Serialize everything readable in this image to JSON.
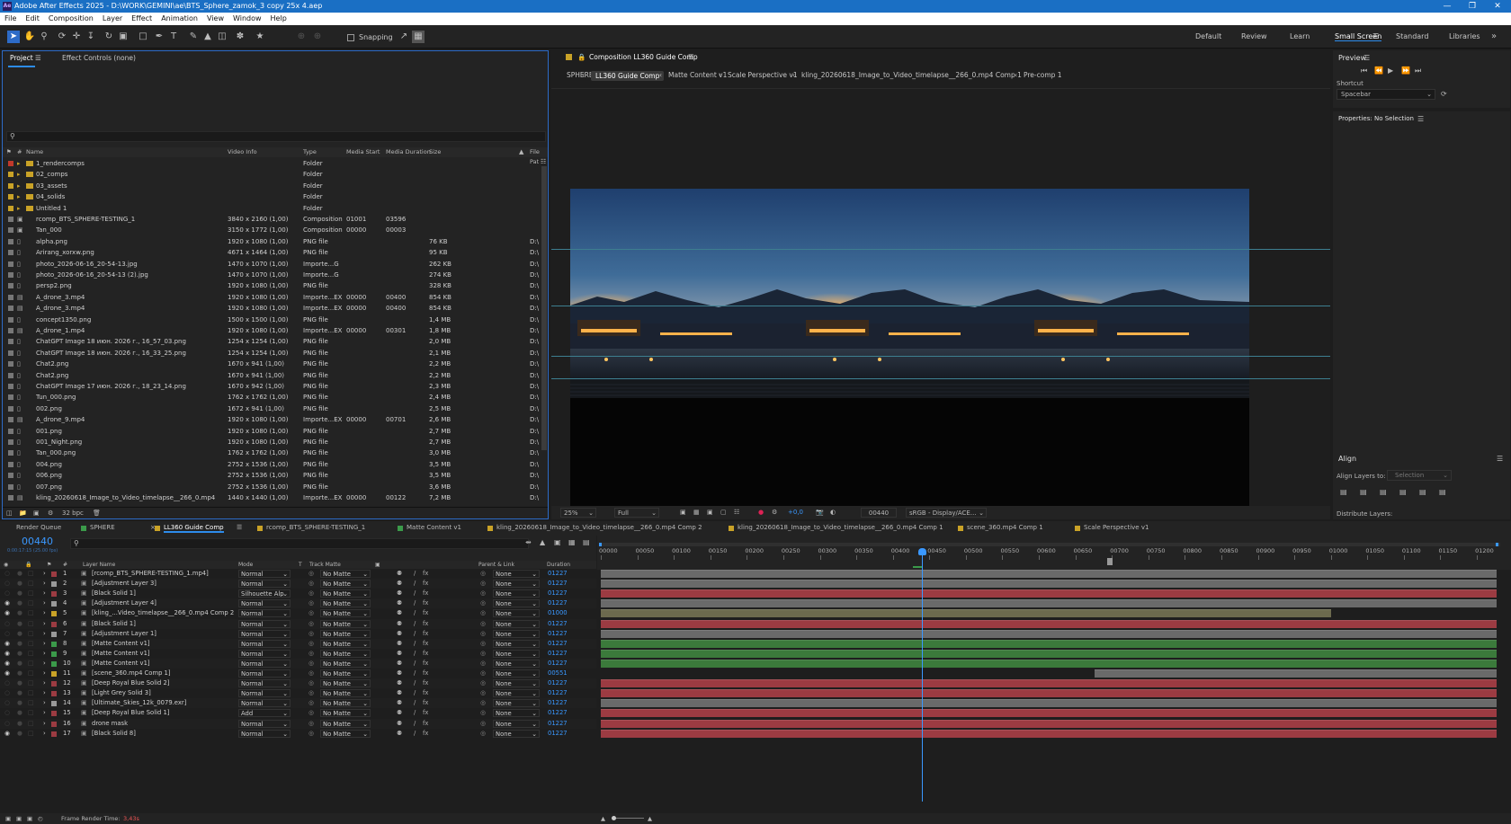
{
  "title": "Adobe After Effects 2025 - D:\\WORK\\GEMINI\\ae\\BTS_Sphere_zamok_3 copy 25x 4.aep",
  "menu": [
    "File",
    "Edit",
    "Composition",
    "Layer",
    "Effect",
    "Animation",
    "View",
    "Window",
    "Help"
  ],
  "toolbar": {
    "snapping": "Snapping"
  },
  "workspaces": [
    "Default",
    "Review",
    "Learn",
    "Small Screen",
    "Standard",
    "Libraries"
  ],
  "colors": {
    "accent": "#2d8ceb",
    "folder": "#c9a227",
    "timecode": "#3a98ff",
    "green": "#3b7a3b",
    "red": "#9c3b42",
    "gray": "#6a6a6a",
    "olive": "#6c6a4e"
  },
  "project": {
    "tab": "Project",
    "tab2": "Effect Controls (none)",
    "search_placeholder": "",
    "cols": [
      "Name",
      "Video Info",
      "Type",
      "Media Start",
      "Media Duration",
      "Size",
      "File Pat"
    ],
    "items": [
      {
        "name": "1_rendercomps",
        "info": "",
        "type": "Folder",
        "start": "",
        "dur": "",
        "size": "",
        "fp": "",
        "c": "#c0392b",
        "k": "folder"
      },
      {
        "name": "02_comps",
        "info": "",
        "type": "Folder",
        "start": "",
        "dur": "",
        "size": "",
        "fp": "",
        "c": "#c9a227",
        "k": "folder"
      },
      {
        "name": "03_assets",
        "info": "",
        "type": "Folder",
        "start": "",
        "dur": "",
        "size": "",
        "fp": "",
        "c": "#c9a227",
        "k": "folder"
      },
      {
        "name": "04_solids",
        "info": "",
        "type": "Folder",
        "start": "",
        "dur": "",
        "size": "",
        "fp": "",
        "c": "#c9a227",
        "k": "folder"
      },
      {
        "name": "Untitled 1",
        "info": "",
        "type": "Folder",
        "start": "",
        "dur": "",
        "size": "",
        "fp": "",
        "c": "#c9a227",
        "k": "folder"
      },
      {
        "name": "rcomp_BTS_SPHERE-TESTING_1",
        "info": "3840 x 2160 (1,00)",
        "type": "Composition",
        "start": "01001",
        "dur": "03596",
        "size": "",
        "fp": "",
        "c": "#777",
        "k": "comp"
      },
      {
        "name": "Tan_000",
        "info": "3150 x 1772 (1,00)",
        "type": "Composition",
        "start": "00000",
        "dur": "00003",
        "size": "",
        "fp": "",
        "c": "#777",
        "k": "comp"
      },
      {
        "name": "alpha.png",
        "info": "1920 x 1080 (1,00)",
        "type": "PNG file",
        "start": "",
        "dur": "",
        "size": "76 KB",
        "fp": "D:\\",
        "c": "#777",
        "k": "file"
      },
      {
        "name": "Arirang_xorxw.png",
        "info": "4671 x 1464 (1,00)",
        "type": "PNG file",
        "start": "",
        "dur": "",
        "size": "95 KB",
        "fp": "D:\\",
        "c": "#777",
        "k": "file"
      },
      {
        "name": "photo_2026-06-16_20-54-13.jpg",
        "info": "1470 x 1070 (1,00)",
        "type": "Importe...G",
        "start": "",
        "dur": "",
        "size": "262 KB",
        "fp": "D:\\",
        "c": "#777",
        "k": "file"
      },
      {
        "name": "photo_2026-06-16_20-54-13 (2).jpg",
        "info": "1470 x 1070 (1,00)",
        "type": "Importe...G",
        "start": "",
        "dur": "",
        "size": "274 KB",
        "fp": "D:\\",
        "c": "#777",
        "k": "file"
      },
      {
        "name": "persp2.png",
        "info": "1920 x 1080 (1,00)",
        "type": "PNG file",
        "start": "",
        "dur": "",
        "size": "328 KB",
        "fp": "D:\\",
        "c": "#777",
        "k": "file"
      },
      {
        "name": "A_drone_3.mp4",
        "info": "1920 x 1080 (1,00)",
        "type": "Importe...EX",
        "start": "00000",
        "dur": "00400",
        "size": "854 KB",
        "fp": "D:\\",
        "c": "#777",
        "k": "video"
      },
      {
        "name": "A_drone_3.mp4",
        "info": "1920 x 1080 (1,00)",
        "type": "Importe...EX",
        "start": "00000",
        "dur": "00400",
        "size": "854 KB",
        "fp": "D:\\",
        "c": "#777",
        "k": "video"
      },
      {
        "name": "concept1350.png",
        "info": "1500 x 1500 (1,00)",
        "type": "PNG file",
        "start": "",
        "dur": "",
        "size": "1,4 MB",
        "fp": "D:\\",
        "c": "#777",
        "k": "file"
      },
      {
        "name": "A_drone_1.mp4",
        "info": "1920 x 1080 (1,00)",
        "type": "Importe...EX",
        "start": "00000",
        "dur": "00301",
        "size": "1,8 MB",
        "fp": "D:\\",
        "c": "#777",
        "k": "video"
      },
      {
        "name": "ChatGPT Image 18 июн. 2026 г., 16_57_03.png",
        "info": "1254 x 1254 (1,00)",
        "type": "PNG file",
        "start": "",
        "dur": "",
        "size": "2,0 MB",
        "fp": "D:\\",
        "c": "#777",
        "k": "file"
      },
      {
        "name": "ChatGPT Image 18 июн. 2026 г., 16_33_25.png",
        "info": "1254 x 1254 (1,00)",
        "type": "PNG file",
        "start": "",
        "dur": "",
        "size": "2,1 MB",
        "fp": "D:\\",
        "c": "#777",
        "k": "file"
      },
      {
        "name": "Chat2.png",
        "info": "1670 x 941 (1,00)",
        "type": "PNG file",
        "start": "",
        "dur": "",
        "size": "2,2 MB",
        "fp": "D:\\",
        "c": "#777",
        "k": "file"
      },
      {
        "name": "Chat2.png",
        "info": "1670 x 941 (1,00)",
        "type": "PNG file",
        "start": "",
        "dur": "",
        "size": "2,2 MB",
        "fp": "D:\\",
        "c": "#777",
        "k": "file"
      },
      {
        "name": "ChatGPT Image 17 июн. 2026 г., 18_23_14.png",
        "info": "1670 x 942 (1,00)",
        "type": "PNG file",
        "start": "",
        "dur": "",
        "size": "2,3 MB",
        "fp": "D:\\",
        "c": "#777",
        "k": "file"
      },
      {
        "name": "Tun_000.png",
        "info": "1762 x 1762 (1,00)",
        "type": "PNG file",
        "start": "",
        "dur": "",
        "size": "2,4 MB",
        "fp": "D:\\",
        "c": "#777",
        "k": "file"
      },
      {
        "name": "002.png",
        "info": "1672 x 941 (1,00)",
        "type": "PNG file",
        "start": "",
        "dur": "",
        "size": "2,5 MB",
        "fp": "D:\\",
        "c": "#777",
        "k": "file"
      },
      {
        "name": "A_drone_9.mp4",
        "info": "1920 x 1080 (1,00)",
        "type": "Importe...EX",
        "start": "00000",
        "dur": "00701",
        "size": "2,6 MB",
        "fp": "D:\\",
        "c": "#777",
        "k": "video"
      },
      {
        "name": "001.png",
        "info": "1920 x 1080 (1,00)",
        "type": "PNG file",
        "start": "",
        "dur": "",
        "size": "2,7 MB",
        "fp": "D:\\",
        "c": "#777",
        "k": "file"
      },
      {
        "name": "001_Night.png",
        "info": "1920 x 1080 (1,00)",
        "type": "PNG file",
        "start": "",
        "dur": "",
        "size": "2,7 MB",
        "fp": "D:\\",
        "c": "#777",
        "k": "file"
      },
      {
        "name": "Tan_000.png",
        "info": "1762 x 1762 (1,00)",
        "type": "PNG file",
        "start": "",
        "dur": "",
        "size": "3,0 MB",
        "fp": "D:\\",
        "c": "#777",
        "k": "file"
      },
      {
        "name": "004.png",
        "info": "2752 x 1536 (1,00)",
        "type": "PNG file",
        "start": "",
        "dur": "",
        "size": "3,5 MB",
        "fp": "D:\\",
        "c": "#777",
        "k": "file"
      },
      {
        "name": "006.png",
        "info": "2752 x 1536 (1,00)",
        "type": "PNG file",
        "start": "",
        "dur": "",
        "size": "3,5 MB",
        "fp": "D:\\",
        "c": "#777",
        "k": "file"
      },
      {
        "name": "007.png",
        "info": "2752 x 1536 (1,00)",
        "type": "PNG file",
        "start": "",
        "dur": "",
        "size": "3,6 MB",
        "fp": "D:\\",
        "c": "#777",
        "k": "file"
      },
      {
        "name": "kling_20260618_Image_to_Video_timelapse__266_0.mp4",
        "info": "1440 x 1440 (1,00)",
        "type": "Importe...EX",
        "start": "00000",
        "dur": "00122",
        "size": "7,2 MB",
        "fp": "D:\\",
        "c": "#777",
        "k": "video"
      }
    ],
    "bpc": "32 bpc"
  },
  "comp": {
    "tab": "Composition LL360 Guide Comp",
    "crumbs": [
      "SPHERE",
      "LL360 Guide Comp",
      "Matte Content v1",
      "Scale Perspective v1",
      "kling_20260618_Image_to_Video_timelapse__266_0.mp4 Comp 1",
      "Pre-comp 1"
    ],
    "zoom": "25%",
    "res": "Full",
    "exposure": "+0,0",
    "frame": "00440",
    "colorspace": "sRGB - Display/ACE..."
  },
  "preview": {
    "title": "Preview",
    "shortcut_label": "Shortcut",
    "shortcut": "Spacebar",
    "properties": "Properties: No Selection",
    "align": "Align",
    "align_to_label": "Align Layers to:",
    "align_to": "Selection",
    "distribute": "Distribute Layers:"
  },
  "timeline": {
    "tabs": [
      {
        "label": "Render Queue",
        "c": ""
      },
      {
        "label": "SPHERE",
        "c": "#3b9a4a"
      },
      {
        "label": "LL360 Guide Comp",
        "c": "#c9a227"
      },
      {
        "label": "rcomp_BTS_SPHERE-TESTING_1",
        "c": "#c9a227"
      },
      {
        "label": "Matte Content v1",
        "c": "#3b9a4a"
      },
      {
        "label": "kling_20260618_Image_to_Video_timelapse__266_0.mp4 Comp 2",
        "c": "#c9a227"
      },
      {
        "label": "kling_20260618_Image_to_Video_timelapse__266_0.mp4 Comp 1",
        "c": "#c9a227"
      },
      {
        "label": "scene_360.mp4 Comp 1",
        "c": "#c9a227"
      },
      {
        "label": "Scale Perspective v1",
        "c": "#c9a227"
      }
    ],
    "timecode": "00440",
    "tc_sub": "0:00:17:15 (25.00 fps)",
    "search_placeholder": "",
    "cols": {
      "name": "Layer Name",
      "mode": "Mode",
      "t": "T",
      "matte": "Track Matte",
      "parent": "Parent & Link",
      "dur": "Duration"
    },
    "layers": [
      {
        "n": "1",
        "name": "[rcomp_BTS_SPHERE-TESTING_1.mp4]",
        "mode": "Normal",
        "matte": "No Matte",
        "parent": "None",
        "dur": "01227",
        "c": "#9c3b42",
        "eye": false,
        "bar": "gray",
        "b0": 0,
        "b1": 1
      },
      {
        "n": "2",
        "name": "[Adjustment Layer 3]",
        "mode": "Normal",
        "matte": "No Matte",
        "parent": "None",
        "dur": "01227",
        "c": "#999",
        "eye": false,
        "bar": "gray",
        "b0": 0,
        "b1": 1
      },
      {
        "n": "3",
        "name": "[Black Solid 1]",
        "mode": "Silhouette Alp",
        "matte": "No Matte",
        "parent": "None",
        "dur": "01227",
        "c": "#9c3b42",
        "eye": false,
        "bar": "red",
        "b0": 0,
        "b1": 1
      },
      {
        "n": "4",
        "name": "[Adjustment Layer 4]",
        "mode": "Normal",
        "matte": "No Matte",
        "parent": "None",
        "dur": "01227",
        "c": "#999",
        "eye": true,
        "bar": "gray",
        "b0": 0,
        "b1": 1
      },
      {
        "n": "5",
        "name": "[kling_...Video_timelapse__266_0.mp4 Comp 2]",
        "mode": "Normal",
        "matte": "No Matte",
        "parent": "None",
        "dur": "01000",
        "c": "#c9a227",
        "eye": true,
        "bar": "olive",
        "b0": 0,
        "b1": 0.8155
      },
      {
        "n": "6",
        "name": "[Black Solid 1]",
        "mode": "Normal",
        "matte": "No Matte",
        "parent": "None",
        "dur": "01227",
        "c": "#9c3b42",
        "eye": false,
        "bar": "red",
        "b0": 0,
        "b1": 1
      },
      {
        "n": "7",
        "name": "[Adjustment Layer 1]",
        "mode": "Normal",
        "matte": "No Matte",
        "parent": "None",
        "dur": "01227",
        "c": "#999",
        "eye": false,
        "bar": "gray",
        "b0": 0,
        "b1": 1
      },
      {
        "n": "8",
        "name": "[Matte Content v1]",
        "mode": "Normal",
        "matte": "No Matte",
        "parent": "None",
        "dur": "01227",
        "c": "#3b9a4a",
        "eye": true,
        "bar": "green",
        "b0": 0,
        "b1": 1
      },
      {
        "n": "9",
        "name": "[Matte Content v1]",
        "mode": "Normal",
        "matte": "No Matte",
        "parent": "None",
        "dur": "01227",
        "c": "#3b9a4a",
        "eye": true,
        "bar": "green",
        "b0": 0,
        "b1": 1
      },
      {
        "n": "10",
        "name": "[Matte Content v1]",
        "mode": "Normal",
        "matte": "No Matte",
        "parent": "None",
        "dur": "01227",
        "c": "#3b9a4a",
        "eye": true,
        "bar": "green",
        "b0": 0,
        "b1": 1
      },
      {
        "n": "11",
        "name": "[scene_360.mp4 Comp 1]",
        "mode": "Normal",
        "matte": "No Matte",
        "parent": "None",
        "dur": "00551",
        "c": "#c9a227",
        "eye": true,
        "bar": "gray",
        "b0": 0.551,
        "b1": 1
      },
      {
        "n": "12",
        "name": "[Deep Royal Blue Solid 2]",
        "mode": "Normal",
        "matte": "No Matte",
        "parent": "None",
        "dur": "01227",
        "c": "#9c3b42",
        "eye": false,
        "bar": "red",
        "b0": 0,
        "b1": 1
      },
      {
        "n": "13",
        "name": "[Light Grey Solid 3]",
        "mode": "Normal",
        "matte": "No Matte",
        "parent": "None",
        "dur": "01227",
        "c": "#9c3b42",
        "eye": false,
        "bar": "red",
        "b0": 0,
        "b1": 1
      },
      {
        "n": "14",
        "name": "[Ultimate_Skies_12k_0079.exr]",
        "mode": "Normal",
        "matte": "No Matte",
        "parent": "None",
        "dur": "01227",
        "c": "#999",
        "eye": false,
        "bar": "gray",
        "b0": 0,
        "b1": 1
      },
      {
        "n": "15",
        "name": "[Deep Royal Blue Solid 1]",
        "mode": "Add",
        "matte": "No Matte",
        "parent": "None",
        "dur": "01227",
        "c": "#9c3b42",
        "eye": false,
        "bar": "red",
        "b0": 0,
        "b1": 1
      },
      {
        "n": "16",
        "name": "drone mask",
        "mode": "Normal",
        "matte": "No Matte",
        "parent": "None",
        "dur": "01227",
        "c": "#9c3b42",
        "eye": false,
        "bar": "red",
        "b0": 0,
        "b1": 1
      },
      {
        "n": "17",
        "name": "[Black Solid 8]",
        "mode": "Normal",
        "matte": "No Matte",
        "parent": "None",
        "dur": "01227",
        "c": "#9c3b42",
        "eye": true,
        "bar": "red",
        "b0": 0,
        "b1": 1
      }
    ],
    "ticks": [
      "00000",
      "00050",
      "00100",
      "00150",
      "00200",
      "00250",
      "00300",
      "00350",
      "00400",
      "00450",
      "00500",
      "00550",
      "00600",
      "00650",
      "00700",
      "00750",
      "00800",
      "00850",
      "00900",
      "00950",
      "01000",
      "01050",
      "01100",
      "01150",
      "01200"
    ],
    "playhead": 440,
    "end": 1227,
    "render_label": "Frame Render Time:",
    "render_time": "3,43s"
  }
}
